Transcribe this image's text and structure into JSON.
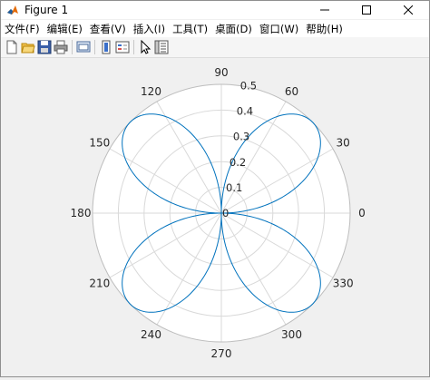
{
  "window": {
    "title": "Figure 1"
  },
  "menu": [
    {
      "label": "文件(F)"
    },
    {
      "label": "编辑(E)"
    },
    {
      "label": "查看(V)"
    },
    {
      "label": "插入(I)"
    },
    {
      "label": "工具(T)"
    },
    {
      "label": "桌面(D)"
    },
    {
      "label": "窗口(W)"
    },
    {
      "label": "帮助(H)"
    }
  ],
  "toolbar": {
    "icons": [
      "new-figure-icon",
      "open-file-icon",
      "save-icon",
      "print-icon",
      "link-plot-icon",
      "insert-colorbar-icon",
      "insert-legend-icon",
      "edit-plot-icon",
      "property-inspector-icon"
    ]
  },
  "colors": {
    "curve": "#0072bd",
    "axes_bg": "#ffffff",
    "grid": "#d9d9d9",
    "tick_text": "#262626"
  },
  "chart_data": {
    "type": "line",
    "coordinate_system": "polar",
    "series": [
      {
        "function": "r = 0.5*|sin(2θ)|",
        "theta_deg": [
          0,
          15,
          30,
          45,
          60,
          75,
          90,
          105,
          120,
          135,
          150,
          165,
          180,
          195,
          210,
          225,
          240,
          255,
          270,
          285,
          300,
          315,
          330,
          345,
          360
        ],
        "r": [
          0,
          0.25,
          0.433,
          0.5,
          0.433,
          0.25,
          0,
          0.25,
          0.433,
          0.5,
          0.433,
          0.25,
          0,
          0.25,
          0.433,
          0.5,
          0.433,
          0.25,
          0,
          0.25,
          0.433,
          0.5,
          0.433,
          0.25,
          0
        ]
      }
    ],
    "theta_ticks": [
      "0",
      "30",
      "60",
      "90",
      "120",
      "150",
      "180",
      "210",
      "240",
      "270",
      "300",
      "330"
    ],
    "r_ticks": [
      "0",
      "0.1",
      "0.2",
      "0.3",
      "0.4",
      "0.5"
    ],
    "rlim": [
      0,
      0.5
    ],
    "grid": true
  }
}
